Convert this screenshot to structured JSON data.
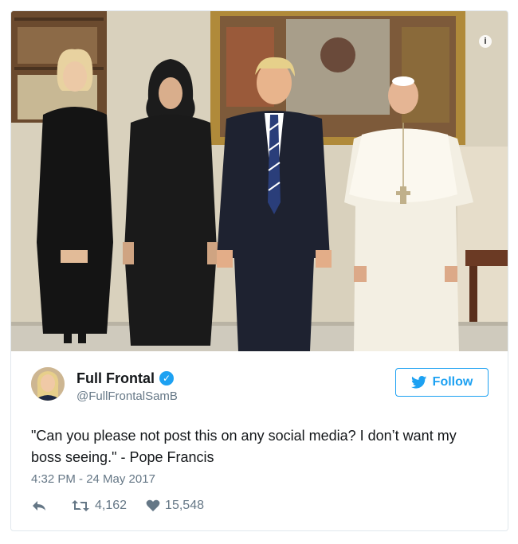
{
  "tweet": {
    "author": {
      "display_name": "Full Frontal",
      "handle": "@FullFrontalSamB",
      "verified": true
    },
    "follow_label": "Follow",
    "text": "\"Can you please not post this on any social media? I don’t want my boss seeing.\" - Pope Francis",
    "timestamp": "4:32 PM - 24 May 2017",
    "retweets": "4,162",
    "likes": "15,548",
    "info_icon": "i"
  },
  "icons": {
    "info": "info-icon",
    "verified": "verified-badge-icon",
    "follow": "twitter-bird-icon",
    "reply": "reply-icon",
    "retweet": "retweet-icon",
    "like": "heart-icon"
  },
  "colors": {
    "accent": "#1da1f2",
    "text": "#14171a",
    "muted": "#657786",
    "border": "#e1e8ed"
  }
}
